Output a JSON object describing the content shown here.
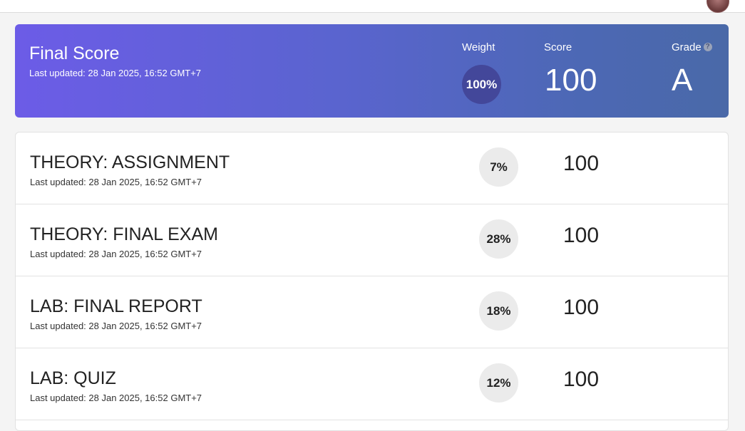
{
  "banner": {
    "title": "Final Score",
    "updated": "Last updated: 28 Jan 2025, 16:52 GMT+7",
    "weight_label": "Weight",
    "score_label": "Score",
    "grade_label": "Grade",
    "help_icon": "?",
    "weight": "100%",
    "score": "100",
    "grade": "A"
  },
  "items": [
    {
      "title": "THEORY: ASSIGNMENT",
      "updated": "Last updated: 28 Jan 2025, 16:52 GMT+7",
      "weight": "7%",
      "score": "100"
    },
    {
      "title": "THEORY: FINAL EXAM",
      "updated": "Last updated: 28 Jan 2025, 16:52 GMT+7",
      "weight": "28%",
      "score": "100"
    },
    {
      "title": "LAB: FINAL REPORT",
      "updated": "Last updated: 28 Jan 2025, 16:52 GMT+7",
      "weight": "18%",
      "score": "100"
    },
    {
      "title": "LAB: QUIZ",
      "updated": "Last updated: 28 Jan 2025, 16:52 GMT+7",
      "weight": "12%",
      "score": "100"
    }
  ],
  "colors": {
    "banner_start": "#6c5ce7",
    "banner_end": "#4a69a8",
    "weight_badge": "#43479a",
    "row_badge": "#ebebeb"
  },
  "icons": {
    "grade_help": "help-circle-icon",
    "avatar": "user-avatar"
  }
}
